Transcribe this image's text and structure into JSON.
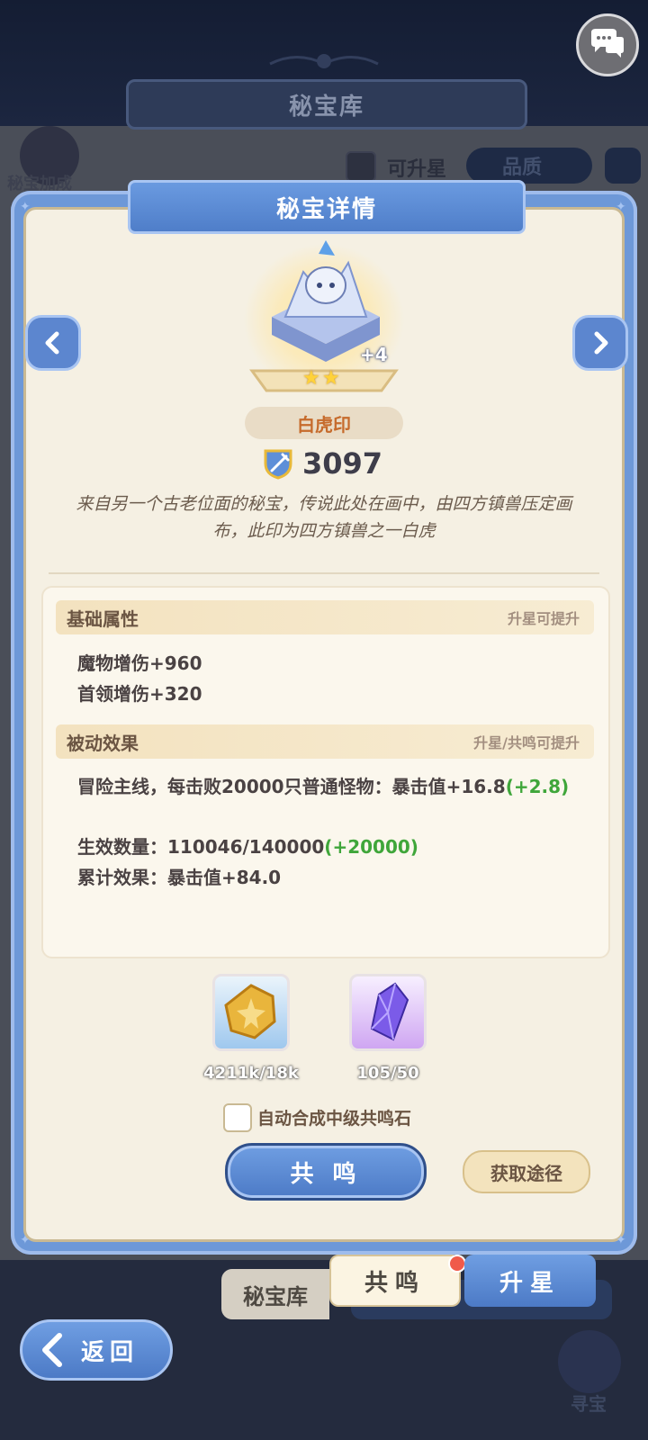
{
  "background": {
    "title": "秘宝库",
    "left_label": "秘宝加成",
    "filter_label": "可升星",
    "quality_label": "品质"
  },
  "dialog": {
    "title": "秘宝详情",
    "item": {
      "name": "白虎印",
      "level": "+4",
      "stars": 2,
      "power": "3097",
      "description": "来自另一个古老位面的秘宝，传说此处在画中，由四方镇兽压定画布，此印为四方镇兽之一白虎"
    },
    "base_attributes": {
      "title": "基础属性",
      "hint": "升星可提升",
      "lines": [
        "魔物增伤+960",
        "首领增伤+320"
      ]
    },
    "passive_effects": {
      "title": "被动效果",
      "hint": "升星/共鸣可提升",
      "effect_main": "冒险主线，每击败20000只普通怪物：暴击值+16.8",
      "effect_bonus": "(+2.8)",
      "count_main": "生效数量：110046/140000",
      "count_bonus": "(+20000)",
      "total": "累计效果：暴击值+84.0"
    },
    "resources": [
      {
        "icon": "gold-coin-icon",
        "amount": "4211k/18k"
      },
      {
        "icon": "purple-crystal-icon",
        "amount": "105/50"
      }
    ],
    "auto_merge_label": "自动合成中级共鸣石",
    "resonate_button": "共 鸣",
    "source_button": "获取途径"
  },
  "tabs": {
    "library": "秘宝库",
    "resonate": "共鸣",
    "upstar": "升星"
  },
  "back_button": "返回",
  "treasure_label": "寻宝",
  "colors": {
    "accent_blue": "#5c86cf",
    "panel_bg": "#f5f0e3",
    "name_text": "#c66b2c",
    "bonus_green": "#3fa63a",
    "notification_red": "#f05a4a"
  }
}
